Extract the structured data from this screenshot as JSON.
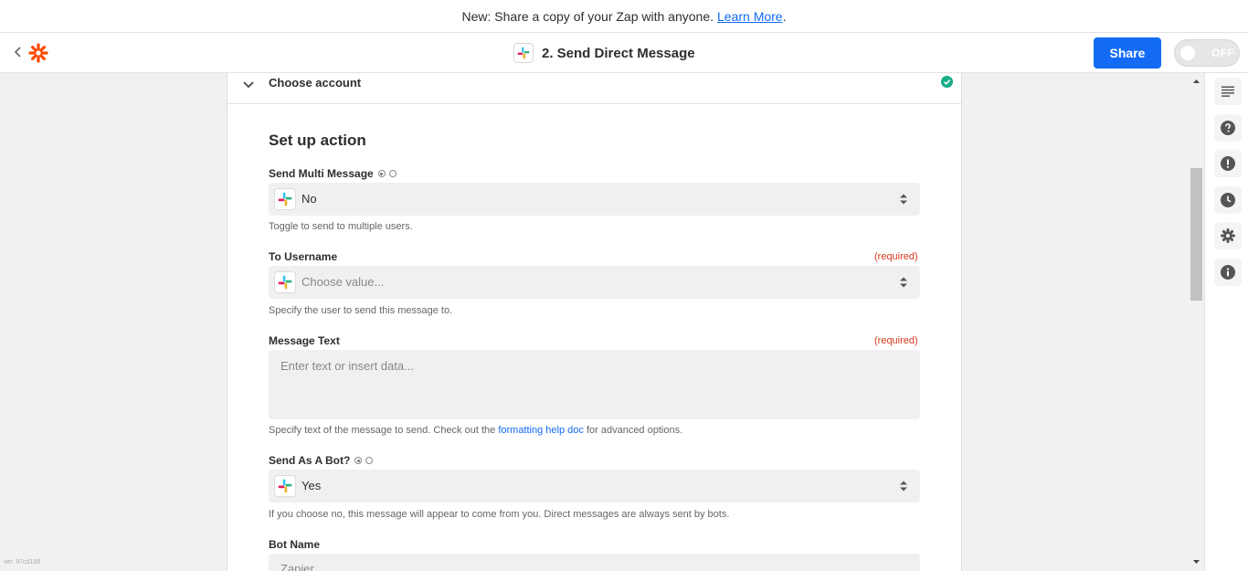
{
  "banner": {
    "text": "New: Share a copy of your Zap with anyone.",
    "link": "Learn More",
    "suffix": "."
  },
  "header": {
    "zap_title": "2. Send Direct Message",
    "share_label": "Share",
    "toggle_label": "OFF"
  },
  "account_section": {
    "title": "Choose account"
  },
  "setup": {
    "title": "Set up action",
    "fields": {
      "multi_message": {
        "label": "Send Multi Message",
        "value": "No",
        "help": "Toggle to send to multiple users."
      },
      "to_username": {
        "label": "To Username",
        "required": "(required)",
        "placeholder": "Choose value...",
        "help": "Specify the user to send this message to."
      },
      "message_text": {
        "label": "Message Text",
        "required": "(required)",
        "placeholder": "Enter text or insert data...",
        "help_before": "Specify text of the message to send. Check out the",
        "help_link": "formatting help doc",
        "help_after": "for advanced options."
      },
      "send_as_bot": {
        "label": "Send As A Bot?",
        "value": "Yes",
        "help": "If you choose no, this message will appear to come from you. Direct messages are always sent by bots."
      },
      "bot_name": {
        "label": "Bot Name",
        "placeholder": "Zapier"
      }
    }
  },
  "sidebar_icons": [
    "details-icon",
    "help-icon",
    "alert-icon",
    "history-icon",
    "settings-icon",
    "info-icon"
  ],
  "version": "ver. 97cd188",
  "colors": {
    "accent": "#136bf5",
    "zapier_orange": "#ff4a00",
    "required": "#d9381e",
    "success": "#1aaf8b"
  }
}
